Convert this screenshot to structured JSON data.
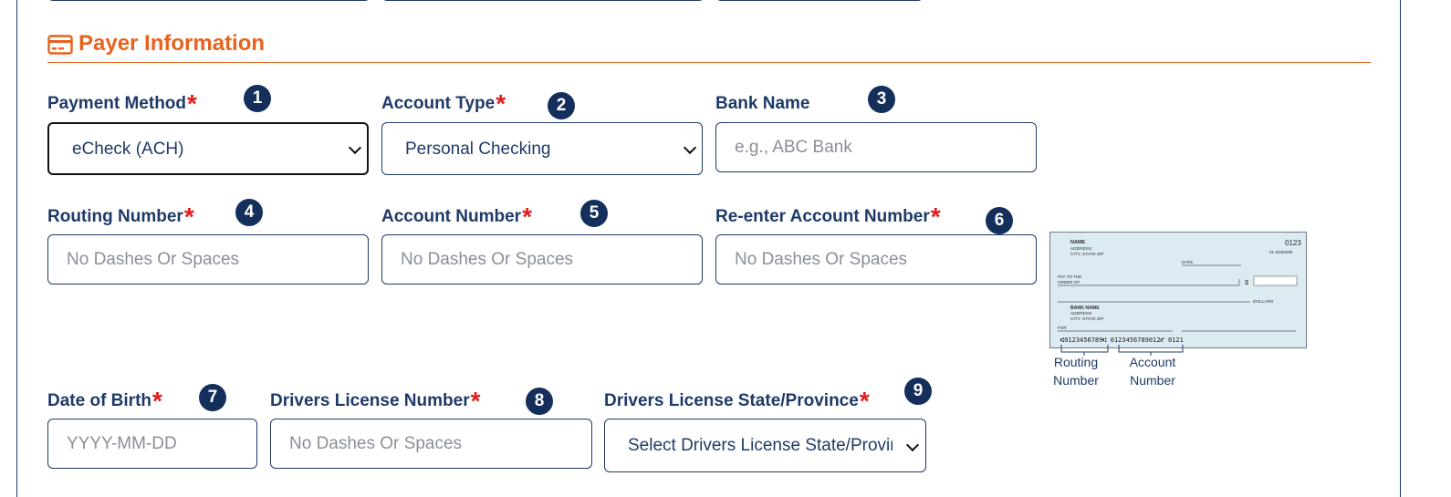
{
  "section": {
    "title": "Payer Information",
    "icon": "credit-card-icon",
    "accent_color": "#e8621c"
  },
  "fields": {
    "payment_method": {
      "label": "Payment Method",
      "required": "*",
      "badge": "1",
      "value": "eCheck (ACH)"
    },
    "account_type": {
      "label": "Account Type",
      "required": "*",
      "badge": "2",
      "value": "Personal Checking"
    },
    "bank_name": {
      "label": "Bank Name",
      "badge": "3",
      "placeholder": "e.g., ABC Bank"
    },
    "routing_number": {
      "label": "Routing Number",
      "required": "*",
      "badge": "4",
      "placeholder": "No Dashes Or Spaces"
    },
    "account_number": {
      "label": "Account Number",
      "required": "*",
      "badge": "5",
      "placeholder": "No Dashes Or Spaces"
    },
    "reenter_account_number": {
      "label": "Re-enter Account Number",
      "required": "*",
      "badge": "6",
      "placeholder": "No Dashes Or Spaces"
    },
    "date_of_birth": {
      "label": "Date of Birth",
      "required": "*",
      "badge": "7",
      "placeholder": "YYYY-MM-DD"
    },
    "drivers_license_number": {
      "label": "Drivers License Number",
      "required": "*",
      "badge": "8",
      "placeholder": "No Dashes Or Spaces"
    },
    "drivers_license_state": {
      "label": "Drivers License State/Province",
      "required": "*",
      "badge": "9",
      "value": "Select Drivers License State/Province"
    }
  },
  "check_image": {
    "number": "0123",
    "fraction": "01-23456/89",
    "name": "NAME",
    "address": "ADDRESS",
    "city": "CITY, STATE  ZIP",
    "date_label": "DATE",
    "pay_to_1": "PAY TO THE",
    "pay_to_2": "ORDER OF",
    "dollar_sign": "$",
    "dollars_label": "DOLLARS",
    "bank_name": "BANK NAME",
    "bank_address": "ADDRESS",
    "bank_city": "CITY, STATE  ZIP",
    "for_label": "FOR",
    "micr": "⑆0123456789⑆  0123456789012⑈  0121",
    "routing_caption_1": "Routing",
    "routing_caption_2": "Number",
    "account_caption_1": "Account",
    "account_caption_2": "Number",
    "background_color": "#dcebf2"
  }
}
